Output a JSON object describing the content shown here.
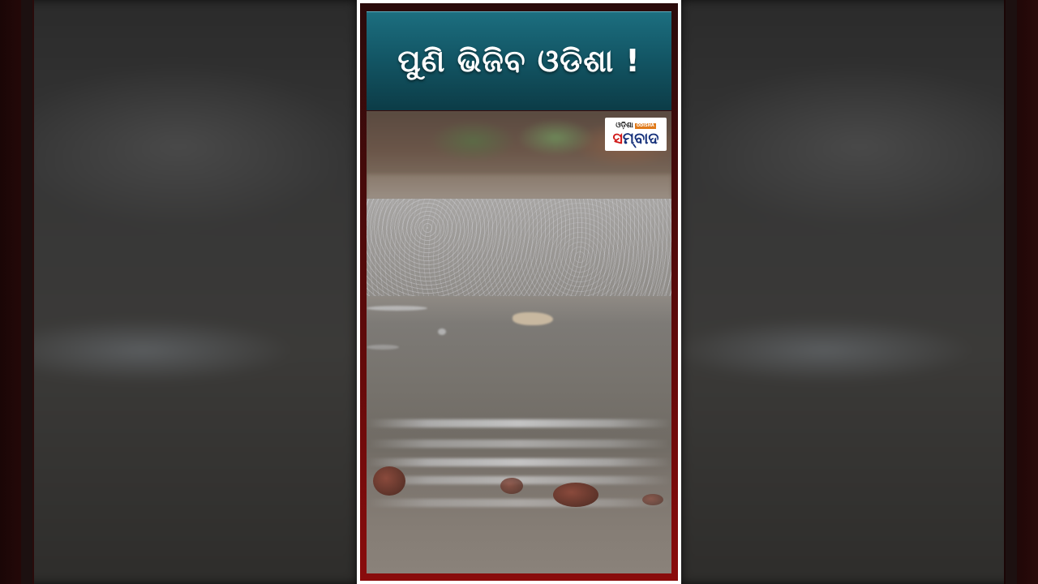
{
  "title": "ପୁଣି ଭିଜିବ ଓଡିଶା !",
  "logo": {
    "top_text": "ଓଡ଼ିଶା",
    "tag_text": "ODISHA",
    "main_accent": "ସ",
    "main_text": "ମ୍ବାଦ"
  },
  "colors": {
    "banner_teal": "#135766",
    "frame_red": "#8a0c0c",
    "logo_blue": "#15307a",
    "logo_red": "#d11a1a"
  },
  "scene": "rain-on-river-photo"
}
